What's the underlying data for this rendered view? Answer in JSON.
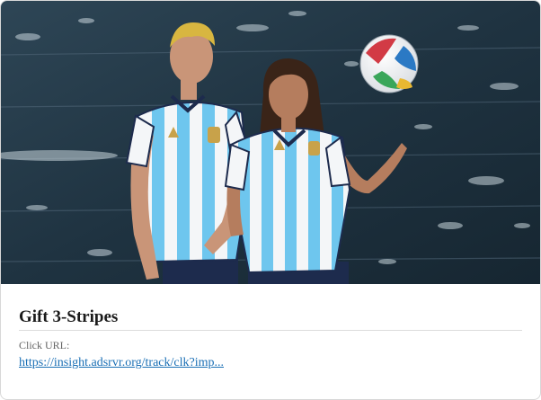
{
  "ad": {
    "title": "Gift 3-Stripes",
    "url_label": "Click URL:",
    "url_text": "https://insight.adsrvr.org/track/clk?imp..."
  },
  "hero": {
    "image_description_icon": "photo-icon",
    "kit_colors": {
      "sky_blue": "#6ec6ee",
      "white": "#f4f6f8",
      "navy": "#1d2b4d",
      "gold": "#c8a24a"
    },
    "wall_color": "#243847"
  }
}
